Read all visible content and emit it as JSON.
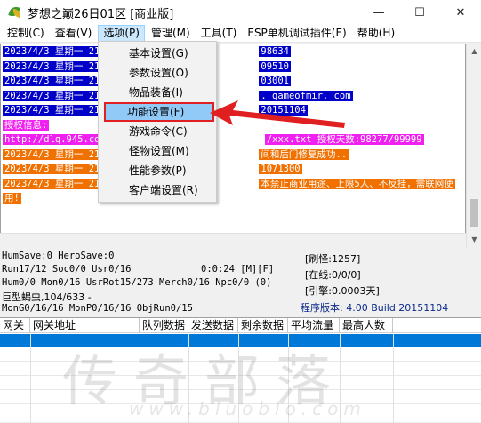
{
  "window": {
    "title": "梦想之巅26日01区 [商业版]",
    "min_label": "—",
    "max_label": "☐",
    "close_label": "✕"
  },
  "menubar": {
    "items": [
      "控制(C)",
      "查看(V)",
      "选项(P)",
      "管理(M)",
      "工具(T)",
      "ESP单机调试插件(E)",
      "帮助(H)"
    ],
    "active_index": 2
  },
  "log": {
    "lines": [
      {
        "text": "2023/4/3 星期一 21",
        "tail": "98634",
        "color": "blue"
      },
      {
        "text": "2023/4/3 星期一 21",
        "tail": "09510",
        "color": "blue"
      },
      {
        "text": "2023/4/3 星期一 21",
        "tail": "03001",
        "color": "blue"
      },
      {
        "text": "2023/4/3 星期一 21",
        "tail": ". gameofmir. com",
        "color": "blue"
      },
      {
        "text": "2023/4/3 星期一 21",
        "tail": "20151104",
        "color": "blue"
      },
      {
        "text": "授权信息:",
        "tail": "",
        "color": "magenta"
      },
      {
        "text": "http://dlq.945.com",
        "tail": "/xxx.txt 授权天数:98277/99999",
        "color": "magenta"
      },
      {
        "text": "2023/4/3 星期一 21",
        "tail": "间和后门修复成功..",
        "color": "orange"
      },
      {
        "text": "2023/4/3 星期一 21",
        "tail": "1071300",
        "color": "orange"
      },
      {
        "text": "2023/4/3 星期一 21",
        "tail": "本禁止商业用途、上限5人、不反挂，需联网使",
        "color": "orange"
      },
      {
        "text": "用!",
        "tail": "",
        "color": "orange"
      }
    ]
  },
  "status": {
    "hum_save": "HumSave:0 HeroSave:0",
    "run": "Run17/12 Soc0/0 Usr0/16",
    "timer": "0:0:24 [M][F]",
    "hum": "Hum0/0 Mon0/16 UsrRot15/273 Merch0/16 Npc0/0 (0)",
    "monster": "巨型蝎虫,104/633 -",
    "mon_gen": "MonG0/16/16 MonP0/16/16 ObjRun0/15",
    "refresh": "[刷怪:1257]",
    "online": "[在线:0/0/0]",
    "engine": "[引擎:0.0003天]",
    "version": "程序版本: 4.00 Build 20151104"
  },
  "gateway_table": {
    "columns": [
      "网关",
      "网关地址",
      "队列数据",
      "发送数据",
      "剩余数据",
      "平均流量",
      "最高人数"
    ]
  },
  "dropdown": {
    "items": [
      "基本设置(G)",
      "参数设置(O)",
      "物品装备(I)",
      "功能设置(F)",
      "游戏命令(C)",
      "怪物设置(M)",
      "性能参数(P)",
      "客户端设置(R)"
    ],
    "highlight_index": 3
  },
  "watermark": {
    "text": "传奇部落",
    "url": "www.bluoblo.com"
  },
  "colors": {
    "log_blue": "#0000c8",
    "log_magenta": "#f020f0",
    "log_orange": "#f07000",
    "selection": "#0078d7",
    "annotation_red": "#e02020"
  }
}
